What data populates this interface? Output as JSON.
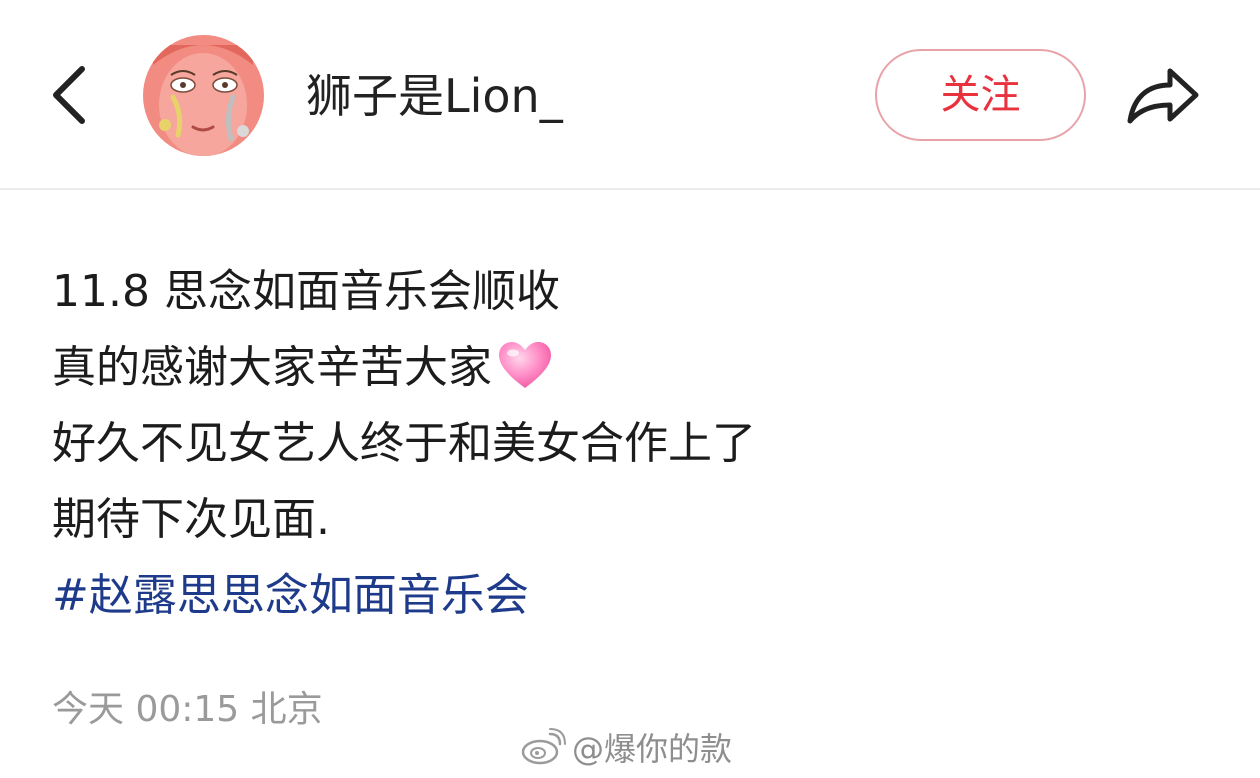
{
  "header": {
    "back_icon": "chevron-left-icon",
    "username": "狮子是Lion_",
    "follow_label": "关注",
    "share_icon": "share-arrow-icon",
    "follow_color": "#e8333f"
  },
  "post": {
    "lines": [
      "11.8 思念如面音乐会顺收",
      "真的感谢大家辛苦大家",
      "好久不见女艺人终于和美女合作上了",
      "期待下次见面."
    ],
    "emoji": "pink-heart-icon",
    "hashtag": "#赵露思思念如面音乐会",
    "hashtag_color": "#1e3a8a"
  },
  "meta": {
    "time_location": "今天 00:15 北京"
  },
  "watermark": {
    "text": "@爆你的款",
    "icon": "weibo-logo-icon"
  }
}
